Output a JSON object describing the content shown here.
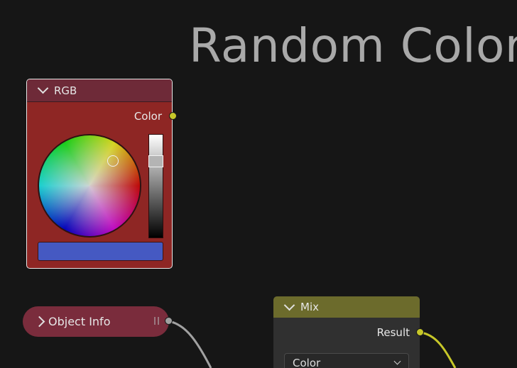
{
  "frame": {
    "label": "Random Color"
  },
  "nodes": {
    "rgb": {
      "title": "RGB",
      "output_label": "Color",
      "color_picker": {
        "value_level": 0.77,
        "swatch_color": "#4559c2"
      }
    },
    "object_info": {
      "title": "Object Info"
    },
    "mix": {
      "title": "Mix",
      "output_label": "Result",
      "data_type": "Color"
    }
  },
  "colors": {
    "background": "#161616",
    "rgb_header": "#6e2a38",
    "rgb_body": "#8e2624",
    "mix_header": "#6c6b2c",
    "color_socket": "#c7c729",
    "geometry_socket": "#a1a1a1"
  }
}
